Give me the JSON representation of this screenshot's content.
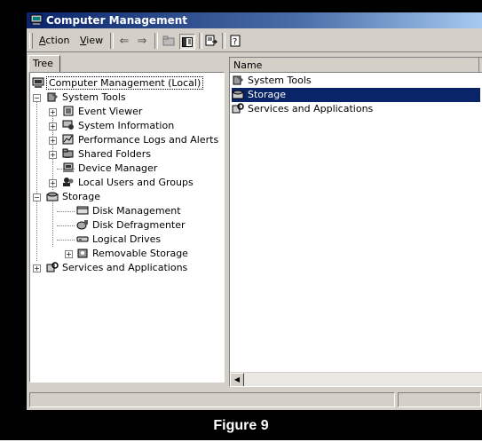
{
  "window": {
    "title": "Computer Management"
  },
  "menu": {
    "action": "Action",
    "view": "View"
  },
  "tree_tab": {
    "label": "Tree"
  },
  "tree": {
    "root": "Computer Management (Local)",
    "system_tools": "System Tools",
    "event_viewer": "Event Viewer",
    "system_information": "System Information",
    "performance_logs": "Performance Logs and Alerts",
    "shared_folders": "Shared Folders",
    "device_manager": "Device Manager",
    "local_users": "Local Users and Groups",
    "storage": "Storage",
    "disk_management": "Disk Management",
    "disk_defragmenter": "Disk Defragmenter",
    "logical_drives": "Logical Drives",
    "removable_storage": "Removable Storage",
    "services": "Services and Applications"
  },
  "list": {
    "column_name": "Name",
    "items": [
      "System Tools",
      "Storage",
      "Services and Applications"
    ],
    "selected_index": 1
  },
  "caption": "Figure 9",
  "colors": {
    "title_start": "#0a246a",
    "title_end": "#a6caf0",
    "selection": "#0a246a",
    "chrome": "#d4d0c8"
  }
}
